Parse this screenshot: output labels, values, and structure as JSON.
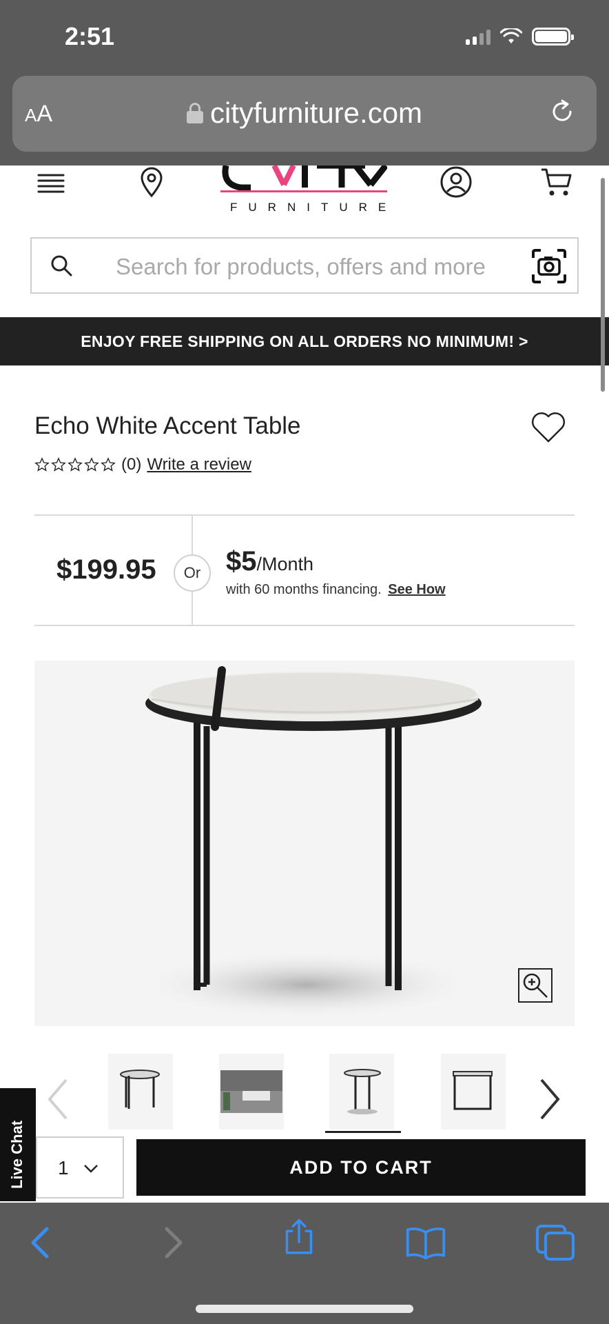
{
  "status_bar": {
    "time": "2:51"
  },
  "browser": {
    "text_size_label_small": "A",
    "text_size_label_large": "A",
    "url": "cityfurniture.com"
  },
  "header": {
    "logo_word": "FURNITURE"
  },
  "search": {
    "placeholder": "Search for products, offers and more"
  },
  "promo": {
    "text": "ENJOY FREE SHIPPING ON ALL ORDERS NO MINIMUM! >"
  },
  "product": {
    "title": "Echo White Accent Table",
    "rating_count": "(0)",
    "review_link": "Write a review",
    "price": "$199.95",
    "or_label": "Or",
    "monthly_amount": "$5",
    "monthly_per": "/Month",
    "financing_text": "with 60 months financing.",
    "see_how": "See How"
  },
  "live_chat": {
    "label": "Live Chat"
  },
  "purchase": {
    "quantity": "1",
    "add_to_cart": "ADD TO CART"
  },
  "colors": {
    "brand_pink": "#e8447f",
    "ios_blue": "#3a8ef0",
    "promo_bg": "#222222"
  }
}
